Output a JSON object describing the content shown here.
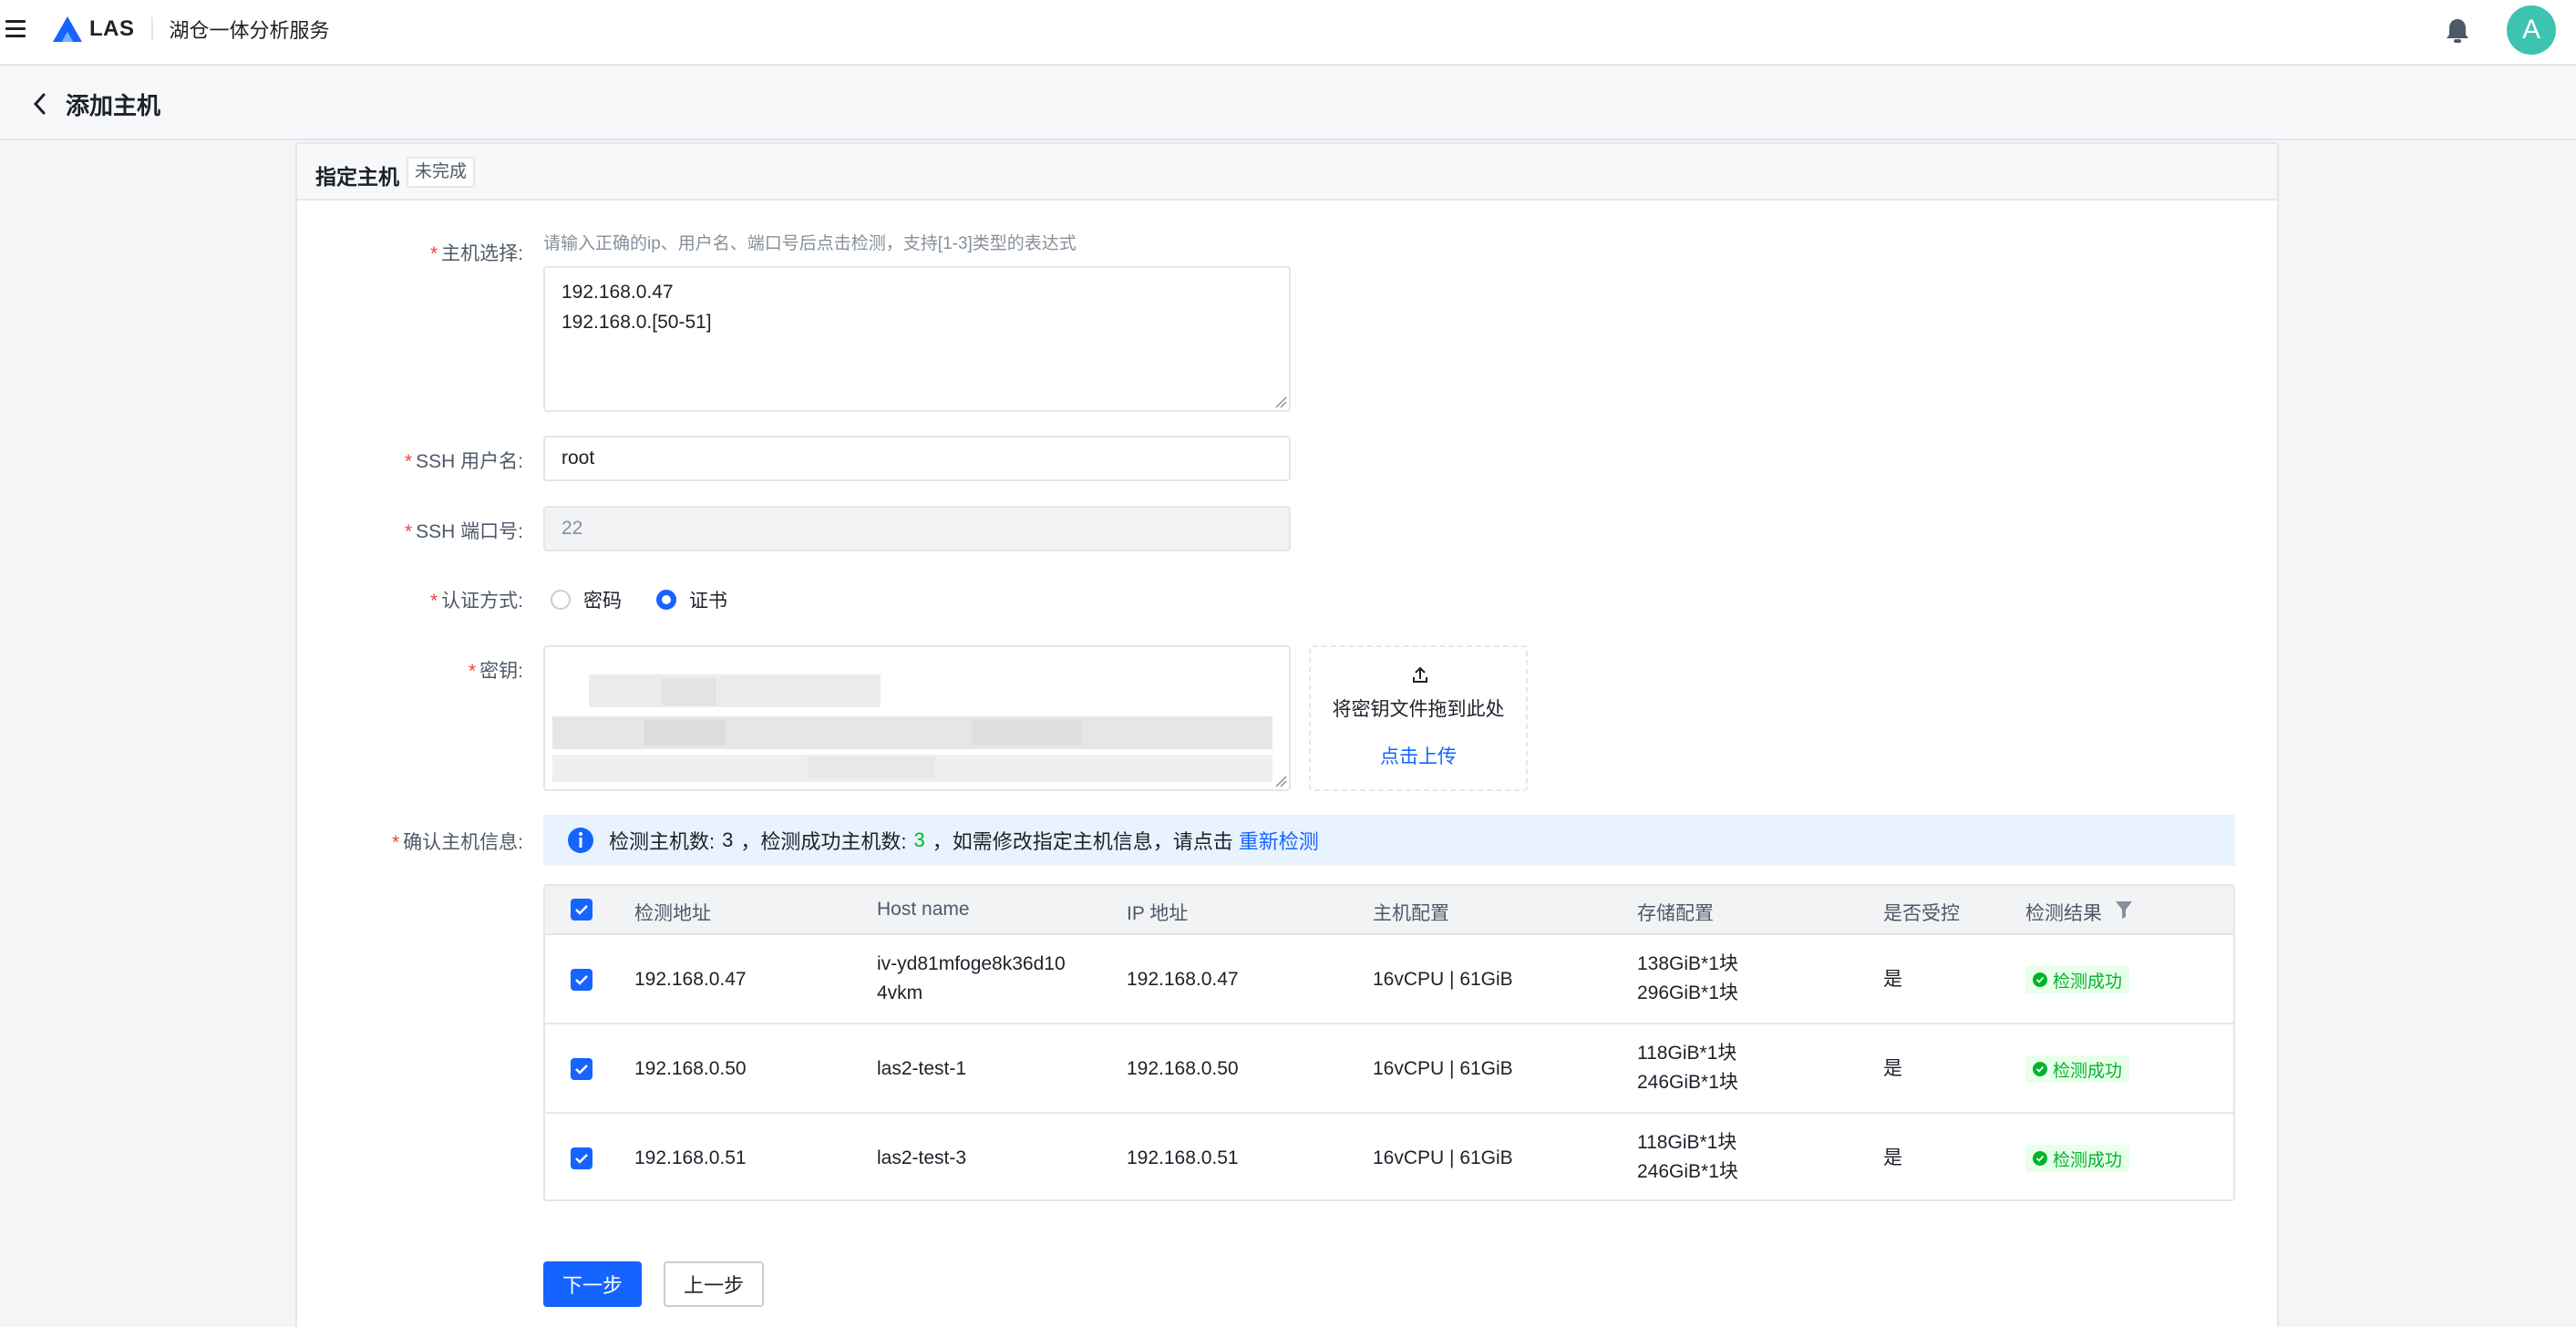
{
  "app": {
    "logo_text": "LAS",
    "service_name": "湖仓一体分析服务",
    "avatar_letter": "A"
  },
  "page": {
    "title": "添加主机"
  },
  "card": {
    "title": "指定主机",
    "tag": "未完成"
  },
  "form": {
    "host_select": {
      "label": "主机选择:",
      "hint": "请输入正确的ip、用户名、端口号后点击检测，支持[1-3]类型的表达式",
      "lines": [
        "192.168.0.47",
        "192.168.0.[50-51]"
      ]
    },
    "ssh_user": {
      "label": "SSH 用户名:",
      "value": "root"
    },
    "ssh_port": {
      "label": "SSH 端口号:",
      "value": "22"
    },
    "auth": {
      "label": "认证方式:",
      "options": [
        "密码",
        "证书"
      ],
      "selected": "证书"
    },
    "key": {
      "label": "密钥:",
      "upload_text": "将密钥文件拖到此处",
      "upload_link": "点击上传"
    },
    "confirm": {
      "label": "确认主机信息:"
    }
  },
  "alert": {
    "prefix": "检测主机数:",
    "total": "3",
    "middle": "，检测成功主机数:",
    "success": "3",
    "suffix": "，如需修改指定主机信息，请点击",
    "link": "重新检测"
  },
  "table": {
    "columns": [
      "检测地址",
      "Host name",
      "IP 地址",
      "主机配置",
      "存储配置",
      "是否受控",
      "检测结果"
    ],
    "rows": [
      {
        "address": "192.168.0.47",
        "hostname_line1": "iv-yd81mfoge8k36d10",
        "hostname_line2": "4vkm",
        "ip": "192.168.0.47",
        "config": "16vCPU | 61GiB",
        "storage_line1": "138GiB*1块",
        "storage_line2": "296GiB*1块",
        "managed": "是",
        "result": "检测成功"
      },
      {
        "address": "192.168.0.50",
        "hostname_line1": "las2-test-1",
        "hostname_line2": "",
        "ip": "192.168.0.50",
        "config": "16vCPU | 61GiB",
        "storage_line1": "118GiB*1块",
        "storage_line2": "246GiB*1块",
        "managed": "是",
        "result": "检测成功"
      },
      {
        "address": "192.168.0.51",
        "hostname_line1": "las2-test-3",
        "hostname_line2": "",
        "ip": "192.168.0.51",
        "config": "16vCPU | 61GiB",
        "storage_line1": "118GiB*1块",
        "storage_line2": "246GiB*1块",
        "managed": "是",
        "result": "检测成功"
      }
    ]
  },
  "buttons": {
    "next": "下一步",
    "prev": "上一步"
  },
  "colors": {
    "primary": "#1664ff",
    "success": "#00b42a",
    "required": "#f53f3f",
    "avatar": "#3cc4b0"
  }
}
